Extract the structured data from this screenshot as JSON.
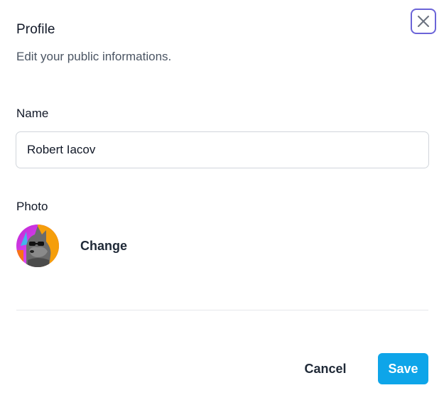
{
  "dialog": {
    "title": "Profile",
    "subtitle": "Edit your public informations."
  },
  "close_button": {
    "icon": "close-icon"
  },
  "name_field": {
    "label": "Name",
    "value": "Robert Iacov"
  },
  "photo_field": {
    "label": "Photo",
    "change_label": "Change",
    "avatar_icon": "avatar"
  },
  "actions": {
    "cancel_label": "Cancel",
    "save_label": "Save"
  },
  "colors": {
    "save_bg": "#0ea5e9",
    "close_border": "#6b64d8"
  }
}
